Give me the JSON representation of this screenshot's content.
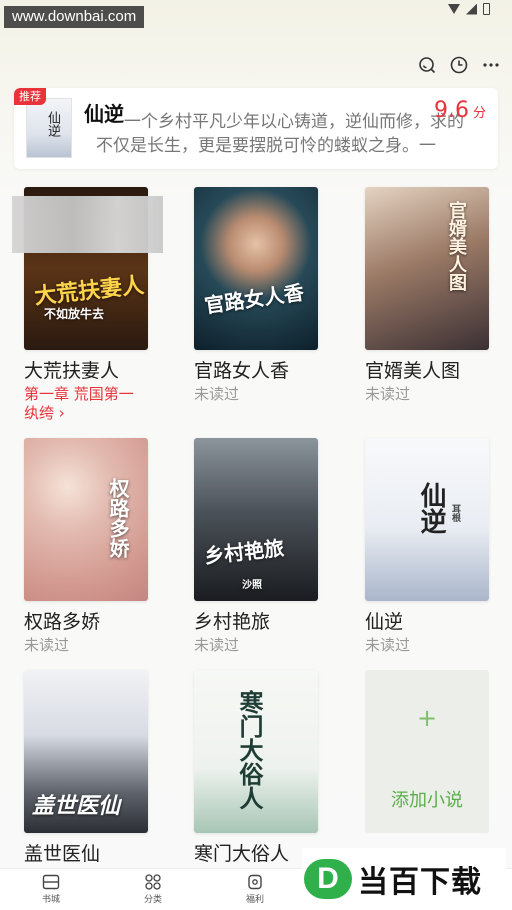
{
  "watermark": {
    "top_text": "www.downbai.com",
    "bottom_logo": "D",
    "bottom_text": "当百下载"
  },
  "recommend": {
    "tag": "推荐",
    "title": "仙逆",
    "cover_title": "仙逆",
    "desc_line1": "一个乡村平凡少年以心铸道，逆仙而修，求的",
    "desc_line2": "不仅是长生，更是要摆脱可怜的蝼蚁之身。一",
    "score": "9.6",
    "score_unit": "分"
  },
  "books": [
    {
      "title": "大荒扶妻人",
      "sub": "第一章 荒国第一纨绔 ›",
      "cover_text": "大荒扶妻人",
      "cover_sub": "不如放牛去",
      "colors": [
        "#3b2414",
        "#7a4a1e"
      ]
    },
    {
      "title": "官路女人香",
      "sub": "未读过",
      "cover_text": "官路女人香",
      "colors": [
        "#0f2a3a",
        "#2b6b7a"
      ]
    },
    {
      "title": "官婿美人图",
      "sub": "未读过",
      "cover_text": "官婿美人图",
      "colors": [
        "#9a7e6a",
        "#d9c3b0"
      ]
    },
    {
      "title": "权路多娇",
      "sub": "未读过",
      "cover_text": "权路多娇",
      "colors": [
        "#e9cfc9",
        "#c99891"
      ]
    },
    {
      "title": "乡村艳旅",
      "sub": "未读过",
      "cover_text": "乡村艳旅",
      "cover_sub": "沙照",
      "colors": [
        "#5d6670",
        "#1f2328"
      ]
    },
    {
      "title": "仙逆",
      "sub": "未读过",
      "cover_text": "仙逆",
      "cover_sub": "耳根",
      "colors": [
        "#f4f6fa",
        "#b8c3d6"
      ]
    },
    {
      "title": "盖世医仙",
      "sub": "",
      "cover_text": "盖世医仙",
      "colors": [
        "#e7eaf0",
        "#3b3f48"
      ]
    },
    {
      "title": "寒门大俗人",
      "sub": "",
      "cover_text": "寒门大俗人",
      "colors": [
        "#f4f6f2",
        "#8fb3a0"
      ]
    }
  ],
  "add_card": {
    "plus": "+",
    "label": "添加小说"
  },
  "nav": [
    {
      "label": "书城",
      "icon": "bookshelf-icon"
    },
    {
      "label": "分类",
      "icon": "grid-icon"
    },
    {
      "label": "福利",
      "icon": "gift-icon"
    },
    {
      "label": "",
      "icon": ""
    },
    {
      "label": "",
      "icon": ""
    }
  ],
  "colors": {
    "accent_red": "#e8333b",
    "accent_green": "#5cae4a",
    "background": "#f9f9f9"
  }
}
